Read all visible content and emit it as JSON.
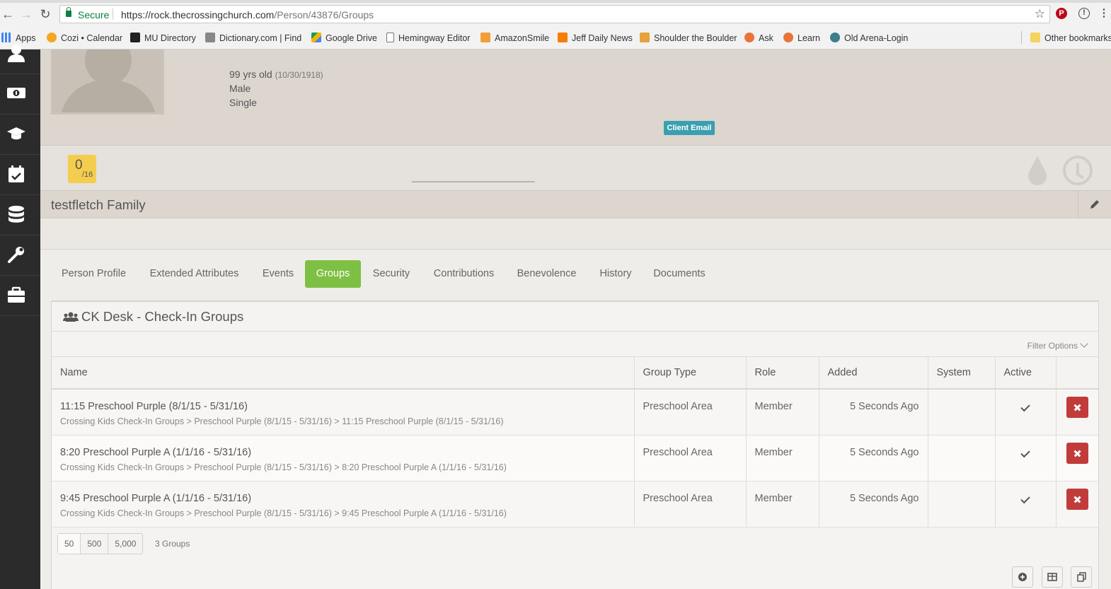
{
  "browser": {
    "secure_label": "Secure",
    "url_host": "https://rock.thecrossingchurch.com",
    "url_path": "/Person/43876/Groups",
    "bookmarks": [
      {
        "label": "Apps"
      },
      {
        "label": "Cozi • Calendar"
      },
      {
        "label": "MU Directory"
      },
      {
        "label": "Dictionary.com | Find"
      },
      {
        "label": "Google Drive"
      },
      {
        "label": "Hemingway Editor"
      },
      {
        "label": "AmazonSmile"
      },
      {
        "label": "Jeff Daily News"
      },
      {
        "label": "Shoulder the Boulder"
      },
      {
        "label": "Ask"
      },
      {
        "label": "Learn"
      },
      {
        "label": "Old Arena-Login"
      },
      {
        "label": "Other bookmarks"
      }
    ]
  },
  "sidebar": {
    "icons": [
      "user-icon",
      "money-icon",
      "graduation-cap-icon",
      "calendar-check-icon",
      "database-icon",
      "wrench-icon",
      "briefcase-icon"
    ]
  },
  "person": {
    "age": "99 yrs old",
    "dob": "(10/30/1918)",
    "gender": "Male",
    "marital_status": "Single",
    "client_email_label": "Client Email",
    "score": "0",
    "score_total": "/16",
    "dashes": "________________________",
    "family_name": "testfletch Family"
  },
  "tabs": [
    {
      "label": "Person Profile",
      "active": false
    },
    {
      "label": "Extended Attributes",
      "active": false
    },
    {
      "label": "Events",
      "active": false
    },
    {
      "label": "Groups",
      "active": true
    },
    {
      "label": "Security",
      "active": false
    },
    {
      "label": "Contributions",
      "active": false
    },
    {
      "label": "Benevolence",
      "active": false
    },
    {
      "label": "History",
      "active": false
    },
    {
      "label": "Documents",
      "active": false
    }
  ],
  "panel": {
    "title": "CK Desk - Check-In Groups",
    "filter_label": "Filter Options",
    "columns": {
      "name": "Name",
      "group_type": "Group Type",
      "role": "Role",
      "added": "Added",
      "system": "System",
      "active": "Active"
    },
    "rows": [
      {
        "name": "11:15 Preschool Purple (8/1/15 - 5/31/16)",
        "path": "Crossing Kids Check-In Groups > Preschool Purple (8/1/15 - 5/31/16) > 11:15 Preschool Purple (8/1/15 - 5/31/16)",
        "group_type": "Preschool Area",
        "role": "Member",
        "added": "5 Seconds Ago",
        "system": "",
        "active": true
      },
      {
        "name": "8:20 Preschool Purple A (1/1/16 - 5/31/16)",
        "path": "Crossing Kids Check-In Groups > Preschool Purple (8/1/15 - 5/31/16) > 8:20 Preschool Purple A (1/1/16 - 5/31/16)",
        "group_type": "Preschool Area",
        "role": "Member",
        "added": "5 Seconds Ago",
        "system": "",
        "active": true
      },
      {
        "name": "9:45 Preschool Purple A (1/1/16 - 5/31/16)",
        "path": "Crossing Kids Check-In Groups > Preschool Purple (8/1/15 - 5/31/16) > 9:45 Preschool Purple A (1/1/16 - 5/31/16)",
        "group_type": "Preschool Area",
        "role": "Member",
        "added": "5 Seconds Ago",
        "system": "",
        "active": true
      }
    ],
    "page_sizes": [
      "50",
      "500",
      "5,000"
    ],
    "count_label": "3 Groups"
  },
  "colors": {
    "active_tab": "#7ec043",
    "delete_button": "#c13b3b",
    "client_email": "#3a9fb0",
    "score_badge": "#f5cd4e",
    "sidebar": "#2b2b2b"
  }
}
